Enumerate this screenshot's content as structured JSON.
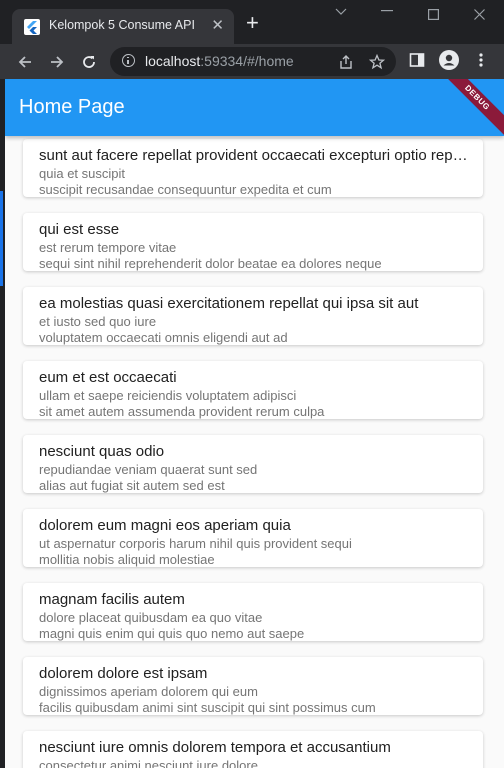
{
  "browser": {
    "tab_title": "Kelompok 5 Consume API",
    "url_host": "localhost",
    "url_rest": ":59334/#/home",
    "icons": [
      "flutter-icon",
      "close-icon",
      "plus-icon",
      "back-icon",
      "forward-icon",
      "reload-icon",
      "info-icon",
      "share-icon",
      "star-icon",
      "sidebar-icon",
      "profile-icon",
      "more-icon"
    ]
  },
  "app": {
    "title": "Home Page",
    "debug_label": "DEBUG",
    "colors": {
      "appbar": "#2196f3",
      "debug": "#8b1a3a"
    }
  },
  "posts": [
    {
      "title": "sunt aut facere repellat provident occaecati excepturi optio reprehenderit",
      "line1": "quia et suscipit",
      "line2": "suscipit recusandae consequuntur expedita et cum"
    },
    {
      "title": "qui est esse",
      "line1": "est rerum tempore vitae",
      "line2": "sequi sint nihil reprehenderit dolor beatae ea dolores neque"
    },
    {
      "title": "ea molestias quasi exercitationem repellat qui ipsa sit aut",
      "line1": "et iusto sed quo iure",
      "line2": "voluptatem occaecati omnis eligendi aut ad"
    },
    {
      "title": "eum et est occaecati",
      "line1": "ullam et saepe reiciendis voluptatem adipisci",
      "line2": "sit amet autem assumenda provident rerum culpa"
    },
    {
      "title": "nesciunt quas odio",
      "line1": "repudiandae veniam quaerat sunt sed",
      "line2": "alias aut fugiat sit autem sed est"
    },
    {
      "title": "dolorem eum magni eos aperiam quia",
      "line1": "ut aspernatur corporis harum nihil quis provident sequi",
      "line2": "mollitia nobis aliquid molestiae"
    },
    {
      "title": "magnam facilis autem",
      "line1": "dolore placeat quibusdam ea quo vitae",
      "line2": "magni quis enim qui quis quo nemo aut saepe"
    },
    {
      "title": "dolorem dolore est ipsam",
      "line1": "dignissimos aperiam dolorem qui eum",
      "line2": "facilis quibusdam animi sint suscipit qui sint possimus cum"
    },
    {
      "title": "nesciunt iure omnis dolorem tempora et accusantium",
      "line1": "consectetur animi nesciunt iure dolore",
      "line2": ""
    }
  ]
}
